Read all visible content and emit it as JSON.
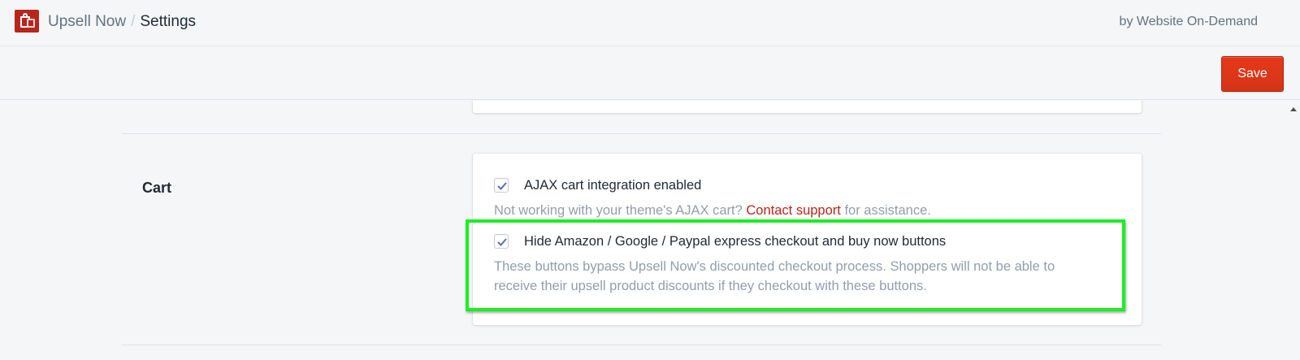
{
  "header": {
    "app_name": "Upsell Now",
    "separator": "/",
    "page_title": "Settings",
    "byline": "by Website On-Demand"
  },
  "toolbar": {
    "save_label": "Save"
  },
  "cart_section": {
    "title": "Cart",
    "ajax_option": {
      "label": "AJAX cart integration enabled",
      "checked": true,
      "help_prefix": "Not working with your theme's AJAX cart?",
      "help_link": "Contact support",
      "help_suffix": "for assistance."
    },
    "hide_buttons_option": {
      "label": "Hide Amazon / Google / Paypal express checkout and buy now buttons",
      "checked": true,
      "help_line1": "These buttons bypass Upsell Now's discounted checkout process. Shoppers will not be able to",
      "help_line2": "receive their upsell product discounts if they checkout with these buttons."
    }
  },
  "colors": {
    "brand": "#b8251b",
    "save_button": "#d53417",
    "highlight": "#18f11f",
    "checkmark": "#5c6ac4"
  },
  "icons": [
    "upsell-now-logo-icon",
    "checkmark-icon",
    "scroll-up-arrow-icon"
  ]
}
